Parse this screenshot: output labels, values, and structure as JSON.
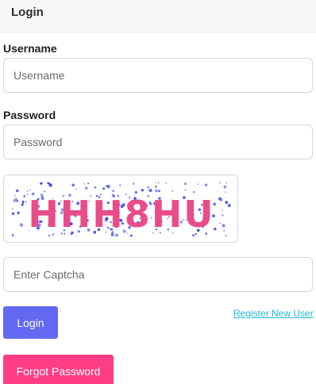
{
  "header": {
    "title": "Login"
  },
  "form": {
    "username": {
      "label": "Username",
      "placeholder": "Username",
      "value": ""
    },
    "password": {
      "label": "Password",
      "placeholder": "Password",
      "value": ""
    },
    "captcha": {
      "text": "HHH8HU",
      "placeholder": "Enter Captcha",
      "value": ""
    },
    "login_label": "Login",
    "register_label": "Register New User",
    "forgot_label": "Forgot Password"
  },
  "colors": {
    "primary": "#6368f2",
    "danger": "#ff3d84",
    "link": "#22b8d1",
    "captcha_text": "#ea4c89",
    "captcha_noise": "#3b47e0"
  }
}
